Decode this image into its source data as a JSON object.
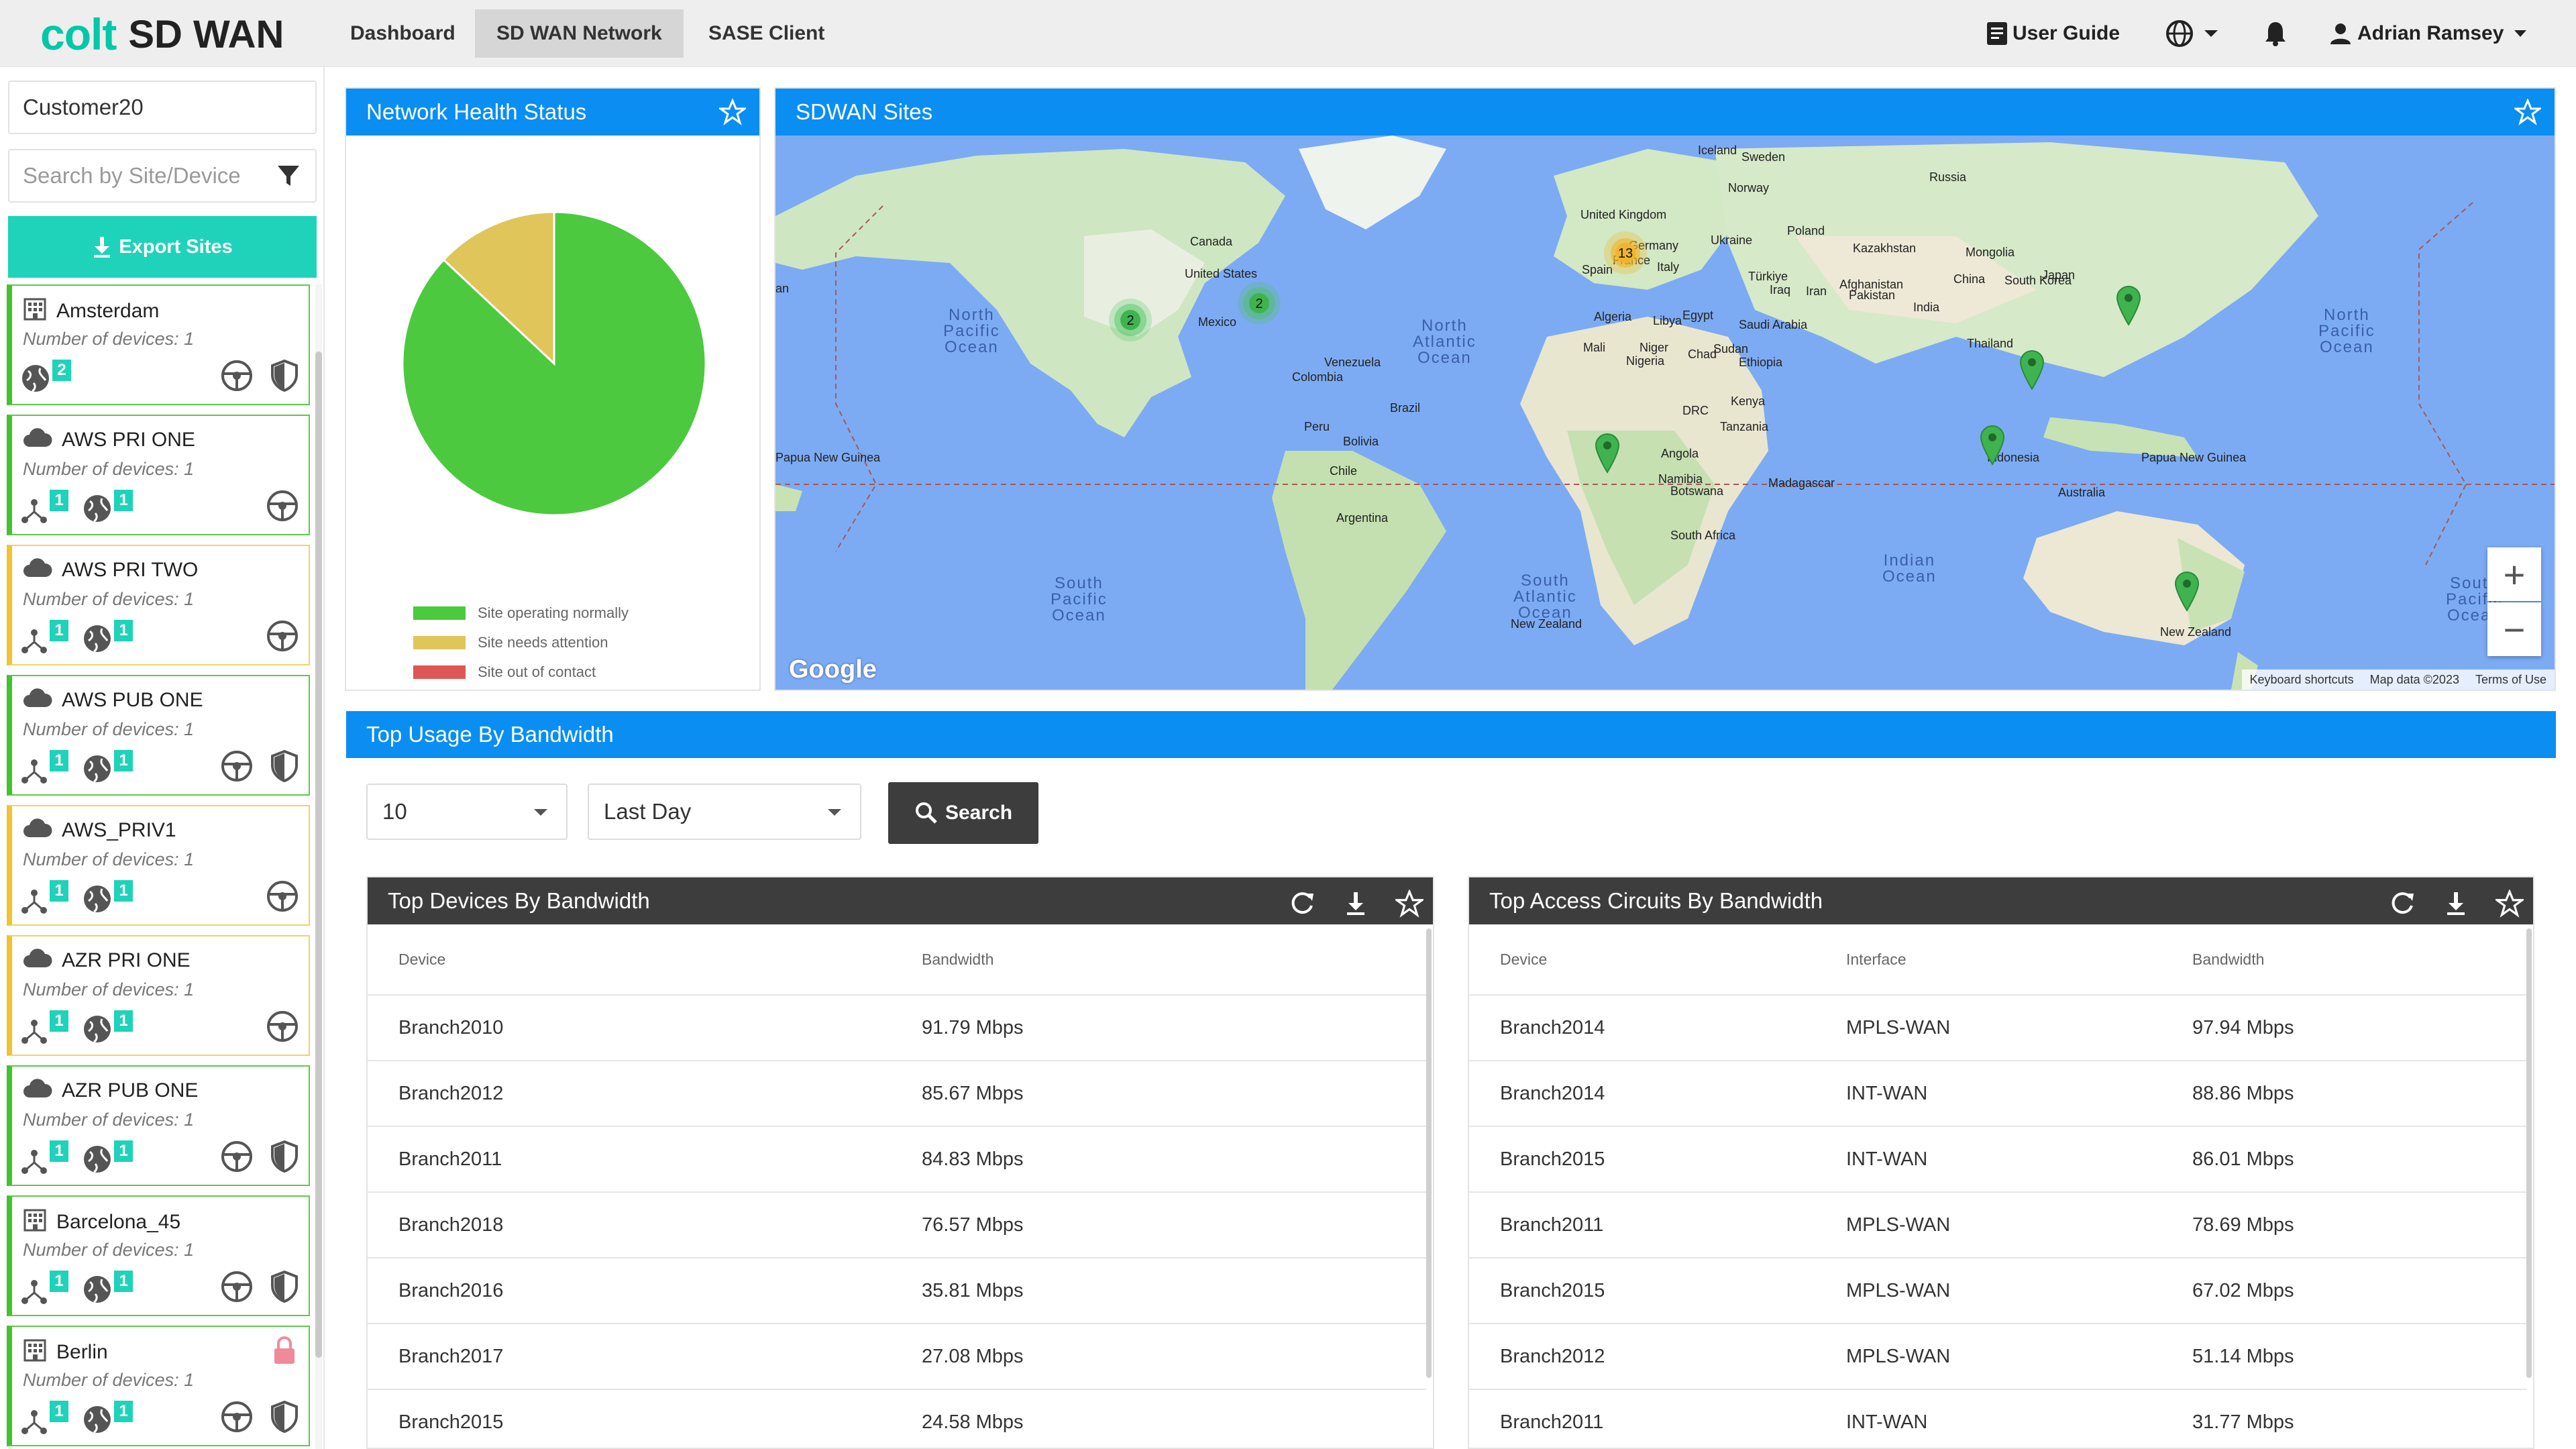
{
  "brand": {
    "logo_colt": "colt",
    "logo_product": "SD WAN",
    "accent": "#1ed3b9"
  },
  "nav": {
    "tabs": [
      {
        "label": "Dashboard",
        "active": false
      },
      {
        "label": "SD WAN Network",
        "active": true
      },
      {
        "label": "SASE Client",
        "active": false
      }
    ],
    "user_guide": "User Guide",
    "user_name": "Adrian Ramsey"
  },
  "sidebar": {
    "customer": "Customer20",
    "search_placeholder": "Search by Site/Device",
    "export_label": "Export Sites",
    "sites": [
      {
        "name": "Amsterdam",
        "devices": "Number of devices: 1",
        "status": "ok",
        "type": "building",
        "badges": [
          "2"
        ]
      },
      {
        "name": "AWS PRI ONE",
        "devices": "Number of devices: 1",
        "status": "ok",
        "type": "cloud",
        "badges": [
          "1",
          "1"
        ]
      },
      {
        "name": "AWS PRI TWO",
        "devices": "Number of devices: 1",
        "status": "warn",
        "type": "cloud",
        "badges": [
          "1",
          "1"
        ]
      },
      {
        "name": "AWS PUB ONE",
        "devices": "Number of devices: 1",
        "status": "ok",
        "type": "cloud",
        "badges": [
          "1",
          "1"
        ]
      },
      {
        "name": "AWS_PRIV1",
        "devices": "Number of devices: 1",
        "status": "warn",
        "type": "cloud",
        "badges": [
          "1",
          "1"
        ]
      },
      {
        "name": "AZR PRI ONE",
        "devices": "Number of devices: 1",
        "status": "warn",
        "type": "cloud",
        "badges": [
          "1",
          "1"
        ]
      },
      {
        "name": "AZR PUB ONE",
        "devices": "Number of devices: 1",
        "status": "ok",
        "type": "cloud",
        "badges": [
          "1",
          "1"
        ]
      },
      {
        "name": "Barcelona_45",
        "devices": "Number of devices: 1",
        "status": "ok",
        "type": "building",
        "badges": [
          "1",
          "1"
        ]
      },
      {
        "name": "Berlin",
        "devices": "Number of devices: 1",
        "status": "ok",
        "type": "building",
        "badges": [
          "1",
          "1"
        ]
      }
    ]
  },
  "health": {
    "title": "Network Health Status",
    "legend": [
      {
        "label": "Site operating normally",
        "color": "#4cc93f"
      },
      {
        "label": "Site needs attention",
        "color": "#e0c55a"
      },
      {
        "label": "Site out of contact",
        "color": "#e05555"
      }
    ],
    "values": {
      "normal": 87,
      "attention": 13,
      "out": 0
    }
  },
  "map": {
    "title": "SDWAN Sites",
    "footer": [
      "Keyboard shortcuts",
      "Map data ©2023",
      "Terms of Use"
    ],
    "google": "Google",
    "clusters": {
      "c1": "2",
      "c2": "2",
      "c3": "13"
    },
    "countries": [
      "Iceland",
      "Sweden",
      "Norway",
      "Russia",
      "United Kingdom",
      "Poland",
      "Germany",
      "Ukraine",
      "France",
      "Italy",
      "Spain",
      "Kazakhstan",
      "Mongolia",
      "Türkiye",
      "Afghanistan",
      "Iraq",
      "Iran",
      "Pakistan",
      "India",
      "China",
      "South Korea",
      "Japan",
      "Algeria",
      "Libya",
      "Egypt",
      "Saudi Arabia",
      "Mali",
      "Niger",
      "Chad",
      "Sudan",
      "Nigeria",
      "Ethiopia",
      "Thailand",
      "Canada",
      "United States",
      "Mexico",
      "Venezuela",
      "Colombia",
      "Peru",
      "Brazil",
      "Bolivia",
      "Chile",
      "Argentina",
      "DRC",
      "Kenya",
      "Tanzania",
      "Angola",
      "Namibia",
      "Botswana",
      "Madagascar",
      "South Africa",
      "Indonesia",
      "Papua New Guinea",
      "Australia",
      "New Zealand",
      "Papua New Guinea",
      "New Zealand",
      "an"
    ],
    "oceans": [
      "North\nPacific\nOcean",
      "North\nAtlantic\nOcean",
      "North\nPacific\nOcean",
      "South\nPacific\nOcean",
      "South\nAtlantic\nOcean",
      "Indian\nOcean",
      "South\nPacific\nOcean"
    ]
  },
  "usage": {
    "title": "Top Usage By Bandwidth",
    "count": "10",
    "period": "Last Day",
    "search_label": "Search",
    "devices_table": {
      "title": "Top Devices By Bandwidth",
      "headers": [
        "Device",
        "Bandwidth"
      ],
      "rows": [
        [
          "Branch2010",
          "91.79 Mbps"
        ],
        [
          "Branch2012",
          "85.67 Mbps"
        ],
        [
          "Branch2011",
          "84.83 Mbps"
        ],
        [
          "Branch2018",
          "76.57 Mbps"
        ],
        [
          "Branch2016",
          "35.81 Mbps"
        ],
        [
          "Branch2017",
          "27.08 Mbps"
        ],
        [
          "Branch2015",
          "24.58 Mbps"
        ]
      ]
    },
    "circuits_table": {
      "title": "Top Access Circuits By Bandwidth",
      "headers": [
        "Device",
        "Interface",
        "Bandwidth"
      ],
      "rows": [
        [
          "Branch2014",
          "MPLS-WAN",
          "97.94 Mbps"
        ],
        [
          "Branch2014",
          "INT-WAN",
          "88.86 Mbps"
        ],
        [
          "Branch2015",
          "INT-WAN",
          "86.01 Mbps"
        ],
        [
          "Branch2011",
          "MPLS-WAN",
          "78.69 Mbps"
        ],
        [
          "Branch2015",
          "MPLS-WAN",
          "67.02 Mbps"
        ],
        [
          "Branch2012",
          "MPLS-WAN",
          "51.14 Mbps"
        ],
        [
          "Branch2011",
          "INT-WAN",
          "31.77 Mbps"
        ]
      ]
    }
  }
}
